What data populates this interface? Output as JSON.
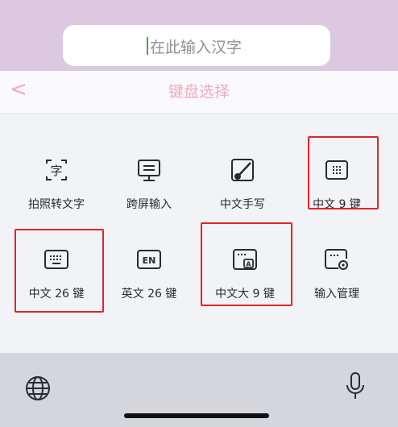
{
  "search": {
    "placeholder": "在此输入汉字"
  },
  "header": {
    "back_icon": "chevron-left-icon",
    "title": "键盘选择"
  },
  "keyboards": [
    {
      "label": "拍照转文字",
      "icon": "photo-text-icon"
    },
    {
      "label": "跨屏输入",
      "icon": "monitor-icon"
    },
    {
      "label": "中文手写",
      "icon": "handwriting-icon"
    },
    {
      "label": "中文 9 键",
      "icon": "keyboard-9-icon",
      "highlighted": true
    },
    {
      "label": "中文 26 键",
      "icon": "keyboard-26-icon",
      "highlighted": true
    },
    {
      "label": "英文 26 键",
      "icon": "en-keyboard-icon"
    },
    {
      "label": "中文大 9 键",
      "icon": "large-keyboard-9-icon",
      "highlighted": true
    },
    {
      "label": "输入管理",
      "icon": "keyboard-settings-icon"
    }
  ],
  "bottom_bar": {
    "left_icon": "globe-icon",
    "right_icon": "microphone-icon"
  },
  "colors": {
    "accent_pink": "#f3a8bf",
    "highlight_red": "#e3242b",
    "top_bg": "#dcc9e1"
  }
}
